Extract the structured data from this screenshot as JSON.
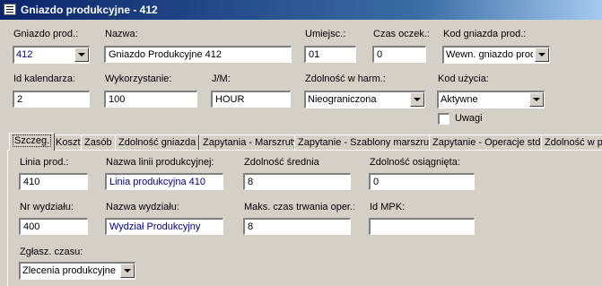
{
  "window": {
    "title": "Gniazdo produkcyjne - 412"
  },
  "header": {
    "gniazdo_prod": {
      "label": "Gniazdo prod.:",
      "value": "412"
    },
    "nazwa": {
      "label": "Nazwa:",
      "value": "Gniazdo Produkcyjne 412"
    },
    "umiejsc": {
      "label": "Umiejsc.:",
      "value": "01"
    },
    "czas_oczek": {
      "label": "Czas oczek.:",
      "value": "0"
    },
    "kod_gniazda": {
      "label": "Kod gniazda prod.:",
      "value": "Wewn. gniazdo prod"
    },
    "id_kalendarza": {
      "label": "Id kalendarza:",
      "value": "2"
    },
    "wykorzystanie": {
      "label": "Wykorzystanie:",
      "value": "100"
    },
    "jm": {
      "label": "J/M:",
      "value": "HOUR"
    },
    "zdolnosc_harm": {
      "label": "Zdolność w harm.:",
      "value": "Nieograniczona"
    },
    "kod_uzycia": {
      "label": "Kod użycia:",
      "value": "Aktywne"
    },
    "uwagi": {
      "label": "Uwagi",
      "checked": false
    }
  },
  "tabs": [
    {
      "label": "Szczeg.",
      "active": true
    },
    {
      "label": "Koszt"
    },
    {
      "label": "Zasób"
    },
    {
      "label": "Zdolność gniazda"
    },
    {
      "label": "Zapytania - Marszruty"
    },
    {
      "label": "Zapytanie - Szablony marszrut"
    },
    {
      "label": "Zapytanie - Operacje std."
    },
    {
      "label": "Zdolność w p"
    }
  ],
  "details": {
    "linia_prod": {
      "label": "Linia prod.:",
      "value": "410"
    },
    "nazwa_linii": {
      "label": "Nazwa linii produkcyjnej:",
      "value": "Linia produkcyjna 410"
    },
    "zdolnosc_srednia": {
      "label": "Zdolność średnia",
      "value": "8"
    },
    "zdolnosc_osiagnieta": {
      "label": "Zdolność osiągnięta:",
      "value": "0"
    },
    "nr_wydzialu": {
      "label": "Nr wydziału:",
      "value": "400"
    },
    "nazwa_wydzialu": {
      "label": "Nazwa wydziału:",
      "value": "Wydział Produkcyjny"
    },
    "maks_czas": {
      "label": "Maks. czas trwania oper.:",
      "value": "8"
    },
    "id_mpk": {
      "label": "Id MPK:",
      "value": ""
    },
    "zglasz_czasu": {
      "label": "Zgłasz. czasu:",
      "value": "Zlecenia produkcyjne"
    }
  }
}
